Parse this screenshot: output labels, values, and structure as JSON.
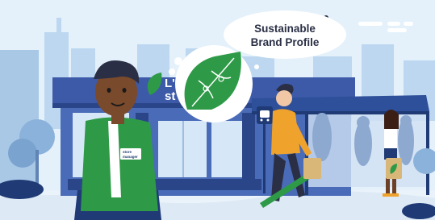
{
  "thought_bubble": {
    "line1": "Sustainable",
    "line2": "Brand Profile"
  },
  "store_sign": {
    "line1": "L'",
    "line2": "st"
  },
  "name_badge": {
    "line1": "store",
    "line2": "manager"
  },
  "icons": {
    "leaf": "leaf-icon",
    "puzzle_leaf": "puzzle-leaf-icon",
    "bus_stop": "bus-stop-icon"
  },
  "colors": {
    "sky": "#dfeefa",
    "city": "#b7d4ee",
    "store": "#3d5aa8",
    "store_dark": "#2b4589",
    "brand_green": "#2e9a47",
    "ground": "#e9f1fa",
    "ink": "#2a2f45"
  }
}
